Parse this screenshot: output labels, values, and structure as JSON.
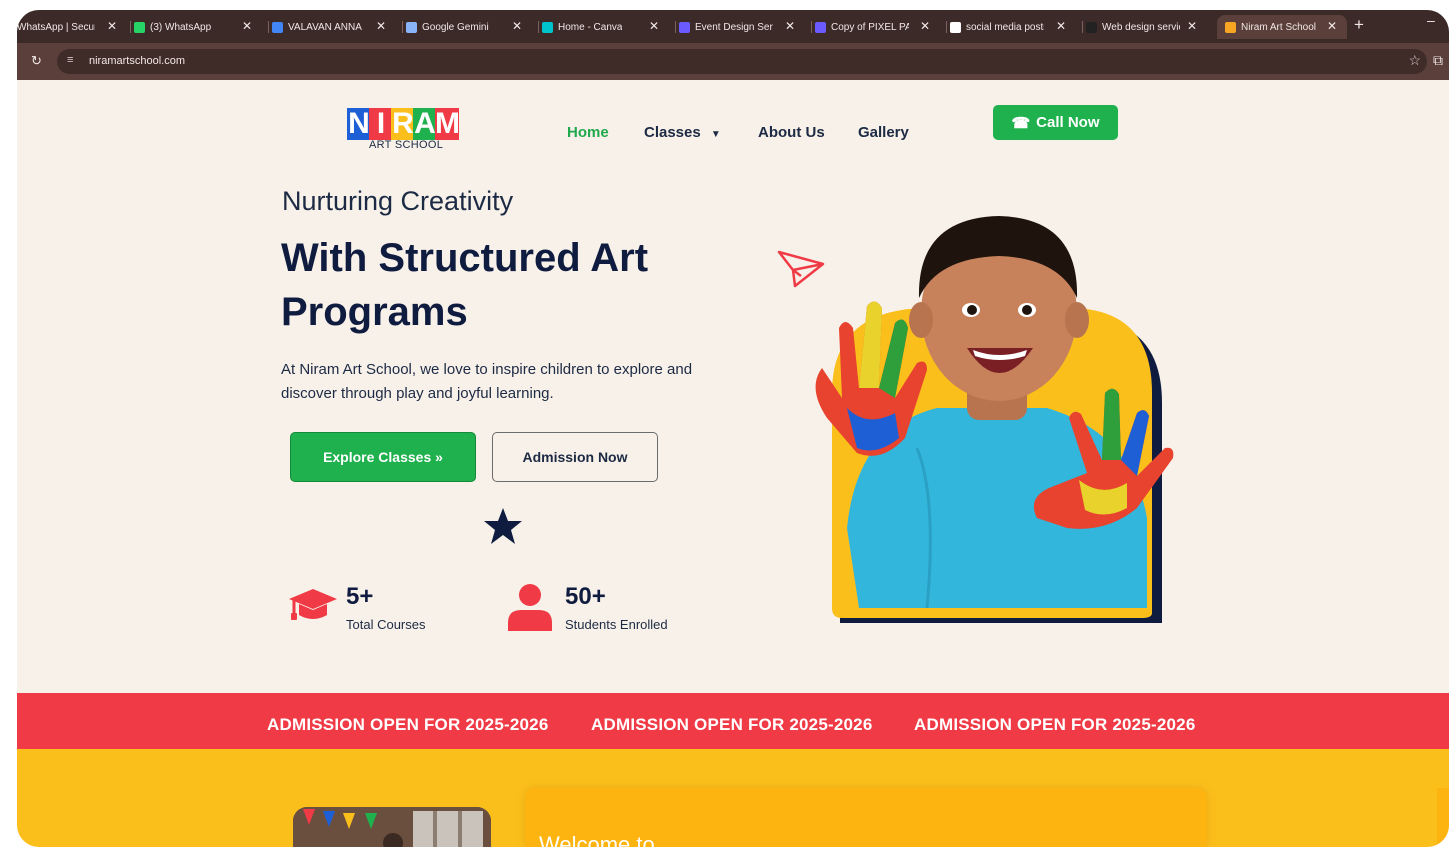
{
  "browser": {
    "tabs": [
      {
        "title": "WhatsApp | Secure",
        "favicon_color": "#25d366"
      },
      {
        "title": "(3) WhatsApp",
        "favicon_color": "#25d366"
      },
      {
        "title": "VALAVAN ANNA",
        "favicon_color": "#4285f4"
      },
      {
        "title": "Google Gemini",
        "favicon_color": "#8ab4f8"
      },
      {
        "title": "Home - Canva",
        "favicon_color": "#00c4cc"
      },
      {
        "title": "Event Design Serv",
        "favicon_color": "#6b5bff"
      },
      {
        "title": "Copy of PIXEL PA",
        "favicon_color": "#6b5bff"
      },
      {
        "title": "social media posts",
        "favicon_color": "#ffffff"
      },
      {
        "title": "Web design servic",
        "favicon_color": "#222222"
      },
      {
        "title": "Niram Art School",
        "favicon_color": "#f6a623",
        "active": true
      }
    ],
    "new_tab_icon": "plus-icon",
    "url": "niramartschool.com"
  },
  "nav": {
    "logo_letters": [
      "N",
      "I",
      "R",
      "A",
      "M"
    ],
    "logo_colors": [
      "#1f5fd6",
      "#f03a45",
      "#fbbf1c",
      "#1fb14d",
      "#f03a45"
    ],
    "logo_sub": "ART SCHOOL",
    "home": "Home",
    "classes": "Classes",
    "about": "About Us",
    "gallery": "Gallery",
    "call_now": "Call Now"
  },
  "hero": {
    "pre_title": "Nurturing Creativity",
    "title_line1": "With Structured Art",
    "title_line2": "Programs",
    "description": "At Niram Art School, we love to inspire children to explore and discover through play and joyful learning.",
    "explore_button": "Explore Classes »",
    "admission_button": "Admission Now",
    "stats": [
      {
        "value": "5+",
        "label": "Total Courses",
        "icon": "graduation-cap-icon"
      },
      {
        "value": "50+",
        "label": "Students Enrolled",
        "icon": "user-icon"
      }
    ]
  },
  "banner": {
    "items": [
      "ADMISSION OPEN FOR 2025-2026",
      "ADMISSION OPEN FOR 2025-2026",
      "ADMISSION OPEN FOR 2025-2026"
    ]
  },
  "about": {
    "welcome": "Welcome to"
  },
  "colors": {
    "brand_green": "#1fb14d",
    "brand_red": "#f03a45",
    "brand_yellow": "#fbbf1c",
    "navy": "#0f1c3f",
    "background": "#f7f1e9"
  }
}
